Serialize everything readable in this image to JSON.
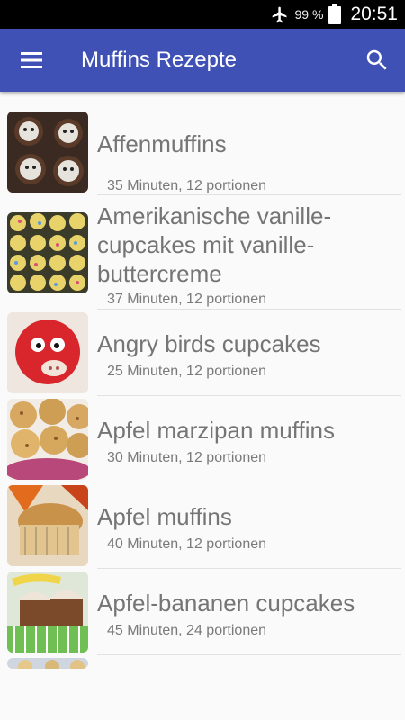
{
  "status_bar": {
    "battery_percent": "99 %",
    "time": "20:51",
    "icons": [
      "airplane-mode-icon",
      "battery-icon"
    ]
  },
  "app_bar": {
    "title": "Muffins Rezepte",
    "icons": [
      "menu-icon",
      "search-icon"
    ]
  },
  "recipes": [
    {
      "title": "Affenmuffins",
      "meta": "35 Minuten, 12 portionen"
    },
    {
      "title": "Amerikanische vanille-cupcakes mit vanille-buttercreme",
      "meta": "37 Minuten, 12 portionen"
    },
    {
      "title": "Angry birds cupcakes",
      "meta": "25 Minuten, 12 portionen"
    },
    {
      "title": "Apfel marzipan muffins",
      "meta": "30 Minuten, 12 portionen"
    },
    {
      "title": "Apfel muffins",
      "meta": "40 Minuten, 12 portionen"
    },
    {
      "title": "Apfel-bananen cupcakes",
      "meta": "45 Minuten, 24 portionen"
    }
  ],
  "colors": {
    "app_bar": "#3f51b5",
    "status_bar": "#000000",
    "background": "#fafafa",
    "title_text": "#757575"
  }
}
